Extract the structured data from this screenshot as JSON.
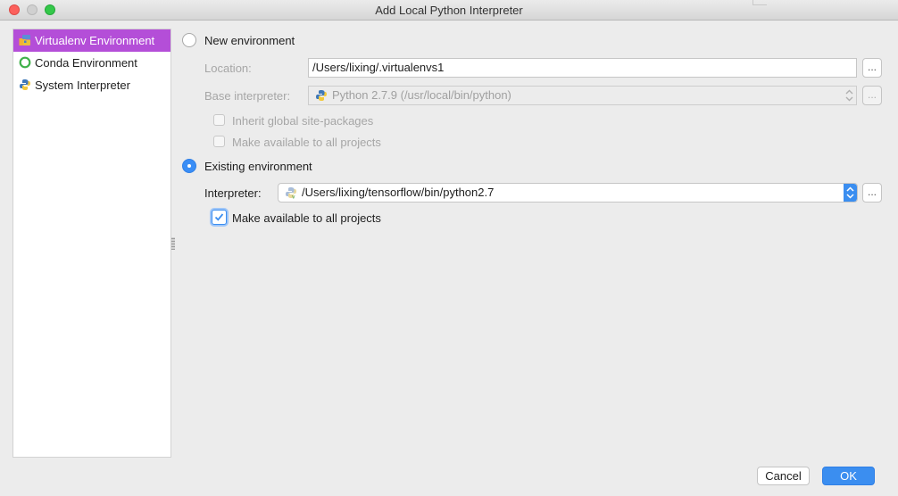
{
  "window": {
    "title": "Add Local Python Interpreter"
  },
  "sidebar": {
    "items": [
      {
        "label": "Virtualenv Environment",
        "icon": "virtualenv-icon",
        "selected": true
      },
      {
        "label": "Conda Environment",
        "icon": "conda-icon",
        "selected": false
      },
      {
        "label": "System Interpreter",
        "icon": "python-icon",
        "selected": false
      }
    ]
  },
  "new_env": {
    "radio_label": "New environment",
    "selected": false,
    "location_label": "Location:",
    "location_value": "/Users/lixing/.virtualenvs1",
    "base_label": "Base interpreter:",
    "base_value": "Python 2.7.9 (/usr/local/bin/python)",
    "inherit_label": "Inherit global site-packages",
    "inherit_checked": false,
    "make_available_label": "Make available to all projects",
    "make_available_checked": false,
    "browse_label": "..."
  },
  "existing_env": {
    "radio_label": "Existing environment",
    "selected": true,
    "interpreter_label": "Interpreter:",
    "interpreter_value": "/Users/lixing/tensorflow/bin/python2.7",
    "make_available_label": "Make available to all projects",
    "make_available_checked": true,
    "browse_label": "..."
  },
  "buttons": {
    "cancel": "Cancel",
    "ok": "OK"
  },
  "colors": {
    "selection": "#b44ed8",
    "accent": "#3b8ef0"
  }
}
